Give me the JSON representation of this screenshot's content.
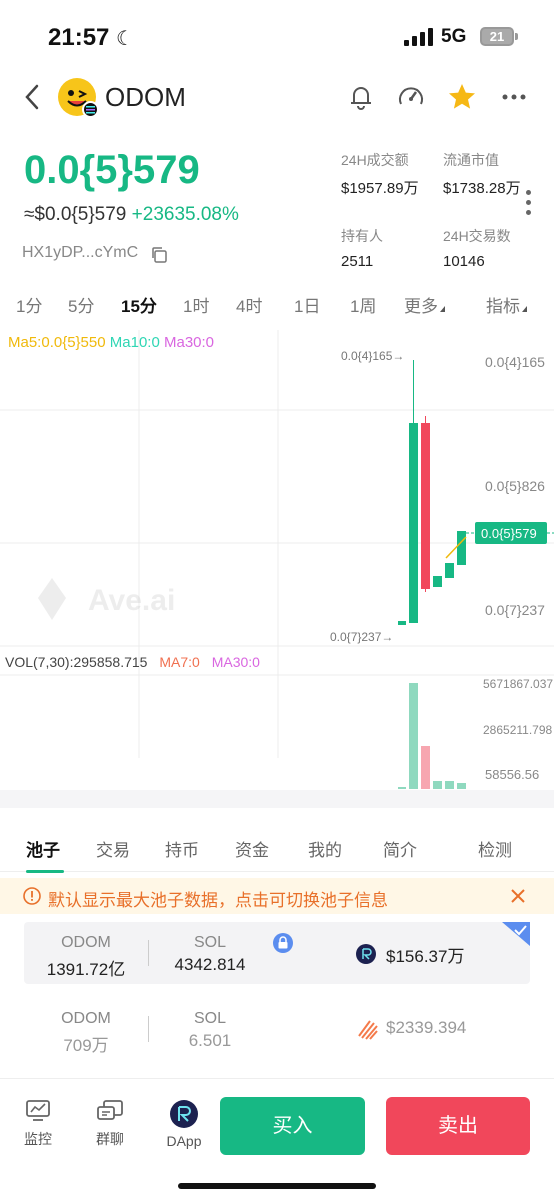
{
  "status_bar": {
    "time": "21:57",
    "network": "5G",
    "battery": "21"
  },
  "header": {
    "token_name": "ODOM"
  },
  "price": {
    "main": "0.0{5}579",
    "usd": "≈$0.0{5}579",
    "change": "+23635.08%",
    "address": "HX1yDP...cYmC"
  },
  "stats": [
    {
      "label": "24H成交额",
      "value": "$1957.89万"
    },
    {
      "label": "流通市值",
      "value": "$1738.28万"
    },
    {
      "label": "持有人",
      "value": "2511"
    },
    {
      "label": "24H交易数",
      "value": "10146"
    }
  ],
  "intervals": [
    {
      "label": "1分"
    },
    {
      "label": "5分"
    },
    {
      "label": "15分"
    },
    {
      "label": "1时"
    },
    {
      "label": "4时"
    },
    {
      "label": "1日"
    },
    {
      "label": "1周"
    },
    {
      "label": "更多"
    },
    {
      "label": "指标"
    }
  ],
  "active_interval": "15分",
  "chart": {
    "ma5": "Ma5:0.0{5}550",
    "ma10": "Ma10:0",
    "ma30": "Ma30:0",
    "price_ticks": [
      "0.0{4}165",
      "0.0{5}826",
      "0.0{7}237"
    ],
    "current_price_label": "0.0{5}579",
    "high_label": "0.0{4}165→",
    "low_label": "0.0{7}237→",
    "watermark": "Ave.ai",
    "vol_label": "VOL(7,30):295858.715",
    "vol_ma7": "MA7:0",
    "vol_ma30": "MA30:0",
    "vol_ticks": [
      "5671867.037",
      "2865211.798",
      "58556.56"
    ],
    "colors": {
      "up": "#17b884",
      "down": "#f1475b",
      "ma5": "#f0b90b",
      "ma10": "#2fd6b4",
      "ma30": "#d966e0"
    }
  },
  "pool_tabs": [
    "池子",
    "交易",
    "持币",
    "资金",
    "我的",
    "简介",
    "检测"
  ],
  "notice": "默认显示最大池子数据，点击可切换池子信息",
  "pools": [
    {
      "sym_a": "ODOM",
      "amt_a": "1391.72亿",
      "sym_b": "SOL",
      "amt_b": "4342.814",
      "liquidity": "$156.37万"
    },
    {
      "sym_a": "ODOM",
      "amt_a": "709万",
      "sym_b": "SOL",
      "amt_b": "6.501",
      "liquidity": "$2339.394"
    }
  ],
  "bottom_nav": [
    {
      "label": "监控",
      "icon": "monitor-icon"
    },
    {
      "label": "群聊",
      "icon": "chat-icon"
    },
    {
      "label": "DApp",
      "icon": "raydium-icon"
    }
  ],
  "buy_label": "买入",
  "sell_label": "卖出"
}
